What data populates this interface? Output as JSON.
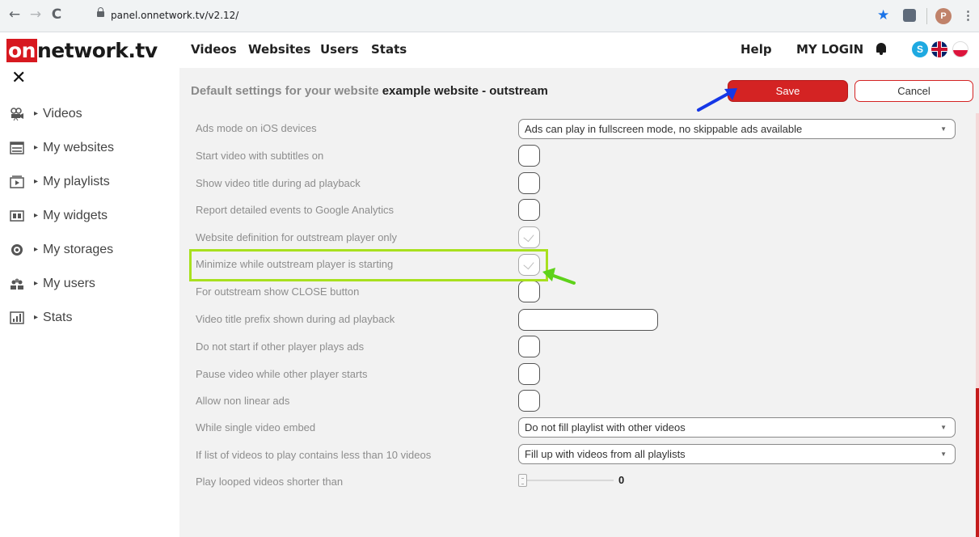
{
  "browser": {
    "url": "panel.onnetwork.tv/v2.12/",
    "profile_initial": "P",
    "back_glyph": "←",
    "forward_glyph": "→",
    "reload_glyph": "C",
    "star_glyph": "★",
    "menu_glyph": "⋮"
  },
  "header": {
    "logo_on": "on",
    "logo_rest": "network.tv",
    "nav": [
      "Videos",
      "Websites",
      "Users",
      "Stats"
    ],
    "help": "Help",
    "login": "MY LOGIN",
    "skype_letter": "S"
  },
  "sidebar": {
    "close_glyph": "✕",
    "triangle": "▸",
    "items": [
      {
        "label": "Videos",
        "icon": "video-camera-icon"
      },
      {
        "label": "My websites",
        "icon": "website-icon"
      },
      {
        "label": "My playlists",
        "icon": "playlist-icon"
      },
      {
        "label": "My widgets",
        "icon": "widget-icon"
      },
      {
        "label": "My storages",
        "icon": "storage-icon"
      },
      {
        "label": "My users",
        "icon": "users-icon"
      },
      {
        "label": "Stats",
        "icon": "stats-icon"
      }
    ]
  },
  "panel": {
    "title_prefix": "Default settings for your website ",
    "title_name": "example website - outstream",
    "save_label": "Save",
    "cancel_label": "Cancel"
  },
  "settings": {
    "ads_mode_ios": {
      "label": "Ads mode on iOS devices",
      "value": "Ads can play in fullscreen mode, no skippable ads available"
    },
    "subtitles_on": {
      "label": "Start video with subtitles on",
      "checked": false
    },
    "show_title_ad": {
      "label": "Show video title during ad playback",
      "checked": false
    },
    "report_events": {
      "label": "Report detailed events to Google Analytics",
      "checked": false
    },
    "outstream_only": {
      "label": "Website definition for outstream player only",
      "checked": true
    },
    "minimize_outstream": {
      "label": "Minimize while outstream player is starting",
      "checked": true
    },
    "close_button": {
      "label": "For outstream show CLOSE button",
      "checked": false
    },
    "title_prefix": {
      "label": "Video title prefix shown during ad playback",
      "value": ""
    },
    "no_start_other_ads": {
      "label": "Do not start if other player plays ads",
      "checked": false
    },
    "pause_other_starts": {
      "label": "Pause video while other player starts",
      "checked": false
    },
    "non_linear_ads": {
      "label": "Allow non linear ads",
      "checked": false
    },
    "single_embed": {
      "label": "While single video embed",
      "value": "Do not fill playlist with other videos"
    },
    "less_than_10": {
      "label": "If list of videos to play contains less than 10 videos",
      "value": "Fill up with videos from all playlists"
    },
    "play_looped": {
      "label": "Play looped videos shorter than",
      "value": "0"
    }
  },
  "colors": {
    "brand_red": "#d42323",
    "highlight_green": "#a8e01e",
    "annotation_blue": "#1537e6",
    "annotation_green": "#5ed21a"
  }
}
